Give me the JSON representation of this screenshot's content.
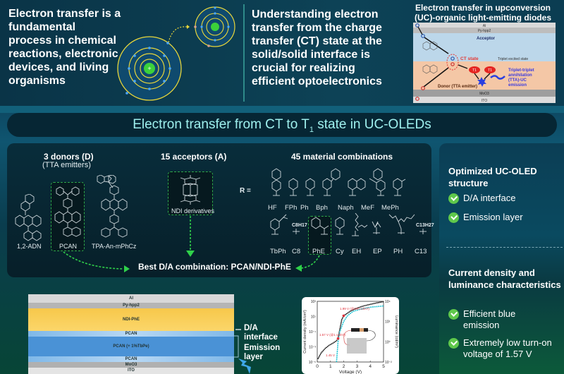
{
  "top": {
    "intro_text": "Electron transfer is a fundamental process in chemical reactions, electronic devices, and living organisms",
    "key_text": "Understanding electron transfer from the charge transfer (CT) state at the solid/solid interface is crucial for realizing efficient optoelectronics",
    "oled_title_line1": "Electron transfer in upconversion",
    "oled_title_line2": "(UC)-organic light-emitting diodes (OLEDs)",
    "oled_diagram": {
      "layers": [
        "Al",
        "Py-hpp2",
        "Acceptor",
        "Donor (TTA emitter)",
        "MoO3",
        "ITO"
      ],
      "ct_state": "CT state",
      "triplet_label": "Triplet excited state",
      "t1": "T1",
      "tta_label": "Triplet-triplet annihilation (TTA)-UC emission",
      "colors": {
        "acceptor": "#bcd7ea",
        "donor": "#f4c7a6",
        "ct": "#e53935",
        "triplet": "#e52521",
        "emission": "#3a3adf"
      }
    }
  },
  "banner": {
    "title_main": "Electron transfer from CT to T",
    "title_sub": "1",
    "title_end": " state in UC-OLEDs"
  },
  "materials": {
    "donors_title": "3 donors (D)",
    "donors_subtitle": "(TTA emitters)",
    "donors": [
      "1,2-ADN",
      "PCAN",
      "TPA-An-mPhCz"
    ],
    "acceptors_title": "15 acceptors (A)",
    "acceptor_label": "NDI derivatives",
    "combinations_title": "45 material combinations",
    "r_prefix": "R =",
    "r_groups_row1": [
      "HF",
      "FPh",
      "Ph",
      "Bph",
      "Naph",
      "MeF",
      "MePh"
    ],
    "r_groups_row2": [
      "TbPh",
      "C8",
      "PhE",
      "Cy",
      "EH",
      "EP",
      "PH",
      "C13"
    ],
    "c8_formula": "C8H17",
    "c13_formula": "C13H27",
    "best_combination": "Best D/A combination: PCAN/NDI-PhE",
    "highlight_color": "#2fd14a"
  },
  "side": {
    "section1_title": "Optimized UC-OLED structure",
    "section1_items": [
      "D/A interface",
      "Emission layer"
    ],
    "section2_title": "Current density and luminance characteristics",
    "section2_items": [
      "Efficient blue emission",
      "Extremely low turn-on voltage of 1.57 V"
    ],
    "check_color": "#5fc84b"
  },
  "device_stack": {
    "layers": [
      "Al",
      "Py-hpp2",
      "NDI-PhE",
      "PCAN",
      "PCAN (+ 1%TbPe)",
      "PCAN",
      "MoO3",
      "ITO"
    ],
    "annot_interface": "D/A interface",
    "annot_emission": "Emission layer"
  },
  "chart_data": {
    "type": "line",
    "xlabel": "Voltage (V)",
    "ylabel": "Current density (mA/cm²)",
    "y2label": "Luminance (cd/m²)",
    "xlim": [
      0,
      5
    ],
    "x_ticks": [
      "0",
      "1",
      "2",
      "3",
      "4",
      "5"
    ],
    "ylim_log": [
      -5,
      3
    ],
    "y_ticks": [
      "10⁻⁵",
      "10⁻³",
      "10⁻¹",
      "10¹",
      "10³"
    ],
    "y2lim_log": [
      -2,
      4
    ],
    "y2_ticks": [
      "10⁻²",
      "10⁰",
      "10²",
      "10⁴"
    ],
    "series": [
      {
        "name": "Current density",
        "axis": "left",
        "color": "#111111",
        "x": [
          0.05,
          0.3,
          0.6,
          0.9,
          1.2,
          1.45,
          1.57,
          1.7,
          1.85,
          2.0,
          2.5,
          3.0,
          3.5,
          4.0,
          4.5,
          5.0
        ],
        "y_log": [
          -4.6,
          -3.8,
          -3.2,
          -2.8,
          -2.5,
          -2.2,
          -1.9,
          -0.7,
          0.6,
          1.1,
          1.7,
          2.1,
          2.4,
          2.6,
          2.8,
          2.95
        ]
      },
      {
        "name": "Luminance",
        "axis": "right",
        "color": "#27c6d6",
        "x": [
          1.45,
          1.5,
          1.57,
          1.7,
          1.99,
          2.3,
          2.7,
          3.2,
          3.7,
          4.2,
          4.7,
          5.0
        ],
        "y_log": [
          -2,
          -1.2,
          0,
          1.0,
          2.0,
          2.6,
          3.0,
          3.2,
          3.35,
          3.45,
          3.5,
          3.55
        ]
      }
    ],
    "annotations": [
      "1.99 V (@100 cd/m²)",
      "1.57 V (@1 cd/m²)",
      "1.45 V"
    ],
    "annotation_color": "#e0303a"
  }
}
